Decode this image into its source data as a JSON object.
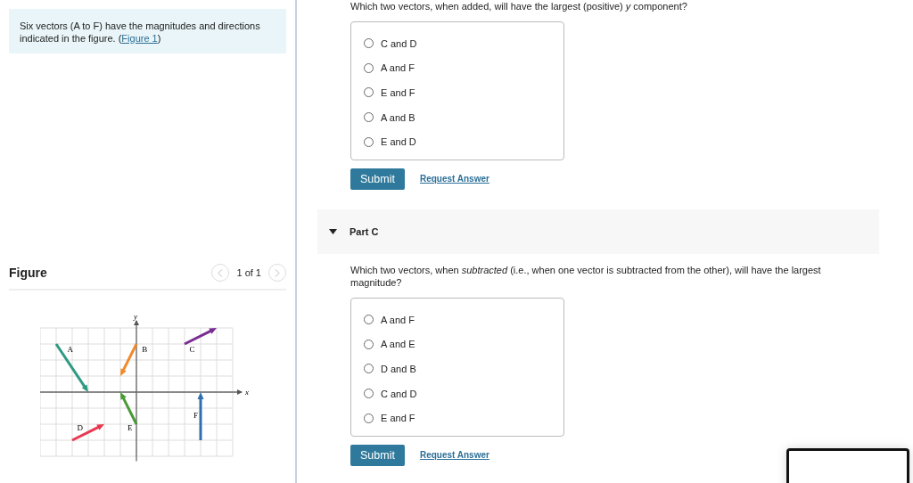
{
  "intro": {
    "text": "Six vectors (A to F) have the magnitudes and directions indicated in the figure. (",
    "link": "Figure 1",
    "after": ")"
  },
  "figure": {
    "title": "Figure",
    "pager": "1 of 1",
    "axis_x": "x",
    "axis_y": "y",
    "vectors": [
      {
        "label": "A",
        "color": "#2f9a82"
      },
      {
        "label": "B",
        "color": "#f08a2c"
      },
      {
        "label": "C",
        "color": "#7a2d90"
      },
      {
        "label": "D",
        "color": "#e8384f"
      },
      {
        "label": "E",
        "color": "#4a9a35"
      },
      {
        "label": "F",
        "color": "#2f6fb0"
      }
    ]
  },
  "parts": [
    {
      "question": "Which two vectors, when added, will have the largest (positive) *y* component?",
      "options": [
        {
          "label": "C and D",
          "selected": false
        },
        {
          "label": "A and F",
          "selected": false
        },
        {
          "label": "E and F",
          "selected": false
        },
        {
          "label": "A and B",
          "selected": false
        },
        {
          "label": "E and D",
          "selected": false
        }
      ],
      "submit": "Submit",
      "request": "Request Answer"
    },
    {
      "header": {
        "title": "Part C",
        "expanded": true
      },
      "question": "Which two vectors, when *subtracted* (i.e., when one vector is subtracted from the other), will have the largest magnitude?",
      "options": [
        {
          "label": "A and F",
          "selected": false
        },
        {
          "label": "A and E",
          "selected": false
        },
        {
          "label": "D and B",
          "selected": false
        },
        {
          "label": "C and D",
          "selected": false
        },
        {
          "label": "E and F",
          "selected": false
        }
      ],
      "submit": "Submit",
      "request": "Request Answer"
    }
  ]
}
